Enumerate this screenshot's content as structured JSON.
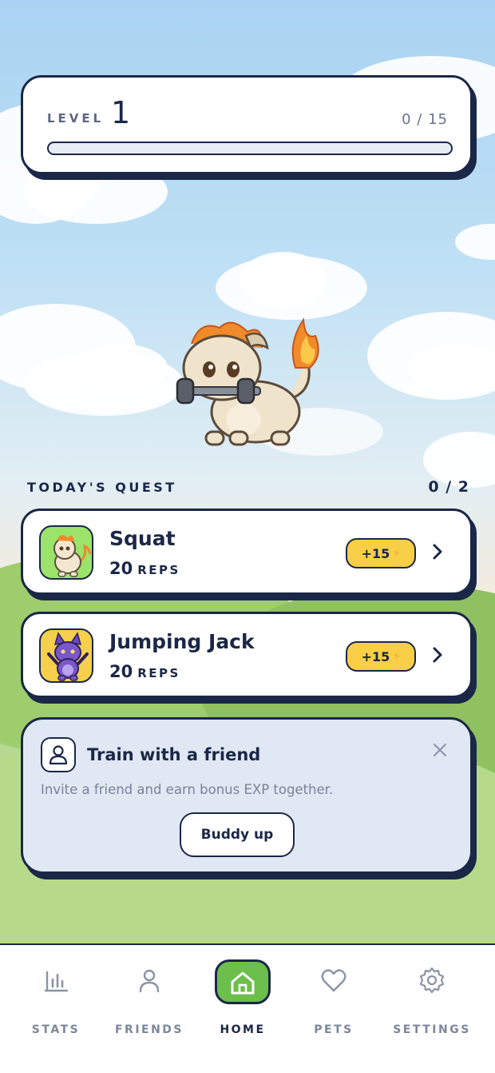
{
  "level": {
    "label": "LEVEL",
    "value": "1",
    "progress_text": "0 / 15",
    "progress": 0
  },
  "quest": {
    "title": "TODAY'S QUEST",
    "count": "0 / 2",
    "items": [
      {
        "name": "Squat",
        "reps": "20",
        "unit": "REPS",
        "xp": "+15",
        "icon": "dragon-pet-icon"
      },
      {
        "name": "Jumping Jack",
        "reps": "20",
        "unit": "REPS",
        "xp": "+15",
        "icon": "fox-pet-icon"
      }
    ]
  },
  "friend_card": {
    "title": "Train with a friend",
    "description": "Invite a friend and earn bonus EXP together.",
    "button": "Buddy up"
  },
  "tabs": [
    {
      "label": "STATS",
      "icon": "bar-chart-icon",
      "active": false
    },
    {
      "label": "FRIENDS",
      "icon": "person-icon",
      "active": false
    },
    {
      "label": "HOME",
      "icon": "home-icon",
      "active": true
    },
    {
      "label": "PETS",
      "icon": "heart-icon",
      "active": false
    },
    {
      "label": "SETTINGS",
      "icon": "gear-icon",
      "active": false
    }
  ],
  "colors": {
    "ink": "#1b2747",
    "accent_green": "#6bbf4a",
    "xp_yellow": "#f8cf47"
  }
}
